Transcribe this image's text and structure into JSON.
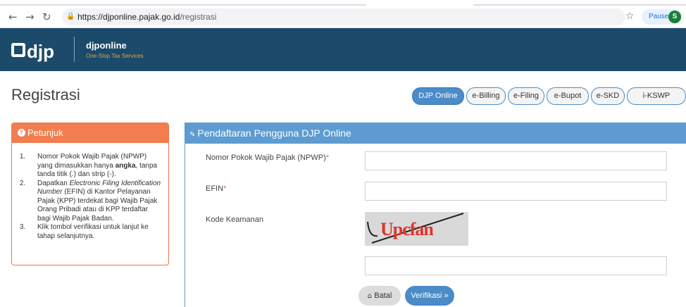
{
  "browser": {
    "url_host": "https://djponline.pajak.go.id",
    "url_path": "/registrasi",
    "paused_label": "Paused",
    "profile_initial": "S"
  },
  "site": {
    "logo_text": "djp",
    "brand_name": "djponline",
    "brand_tagline": "One-Stop Tax Services"
  },
  "page": {
    "title": "Registrasi"
  },
  "tabs": [
    {
      "label": "DJP Online",
      "active": true
    },
    {
      "label": "e-Billing",
      "active": false
    },
    {
      "label": "e-Filing",
      "active": false
    },
    {
      "label": "e-Bupot",
      "active": false
    },
    {
      "label": "e-SKD",
      "active": false
    },
    {
      "label": "i-KSWP",
      "active": false
    }
  ],
  "petunjuk": {
    "title": "Petunjuk",
    "items": [
      {
        "a": "Nomor Pokok Wajib Pajak (NPWP) yang dimasukkan hanya ",
        "b": "angka",
        "c": ", tanpa tanda titik (.) dan strip (-)."
      },
      {
        "a": "Dapatkan ",
        "b": "Electronic Filing Identification Number",
        "c": " (EFIN) di Kantor Pelayanan Pajak (KPP) terdekat bagi Wajib Pajak Orang Pribadi atau di KPP terdaftar bagi Wajib Pajak Badan."
      },
      {
        "a": "Klik tombol verifikasi untuk lanjut ke tahap selanjutnya.",
        "b": "",
        "c": ""
      }
    ]
  },
  "form": {
    "title": "Pendaftaran Pengguna DJP Online",
    "npwp_label": "Nomor Pokok Wajib Pajak (NPWP)",
    "efin_label": "EFIN",
    "required_mark": "*",
    "captcha_label": "Kode Keamanan",
    "captcha_text": "Upcfan",
    "npwp_value": "",
    "efin_value": "",
    "captcha_value": "",
    "batal_label": "Batal",
    "verifikasi_label": "Verifikasi"
  },
  "colors": {
    "header_bg": "#1b4a6b",
    "accent_blue": "#4a8bc8",
    "petunjuk_orange": "#f27d4f"
  }
}
